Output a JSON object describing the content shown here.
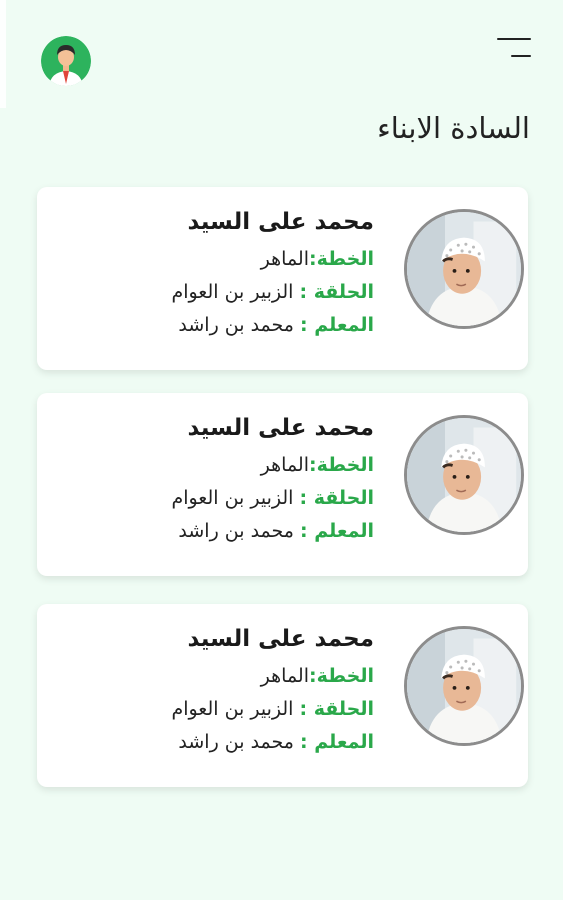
{
  "header": {
    "menu_icon": "menu-icon",
    "avatar_icon": "user-avatar-icon"
  },
  "page_title": "السادة الابناء",
  "colors": {
    "background": "#effcf4",
    "label_green": "#2aa84a",
    "avatar_green": "#2db35d"
  },
  "labels": {
    "plan": "الخطة:",
    "circle": "الحلقة :",
    "teacher": "المعلم :"
  },
  "children": [
    {
      "name": "محمد على السيد",
      "plan": "الماهر",
      "circle": "الزبير بن العوام",
      "teacher": "محمد بن راشد"
    },
    {
      "name": "محمد على السيد",
      "plan": "الماهر",
      "circle": "الزبير بن العوام",
      "teacher": "محمد بن راشد"
    },
    {
      "name": "محمد على السيد",
      "plan": "الماهر",
      "circle": "الزبير بن العوام",
      "teacher": "محمد بن راشد"
    }
  ]
}
